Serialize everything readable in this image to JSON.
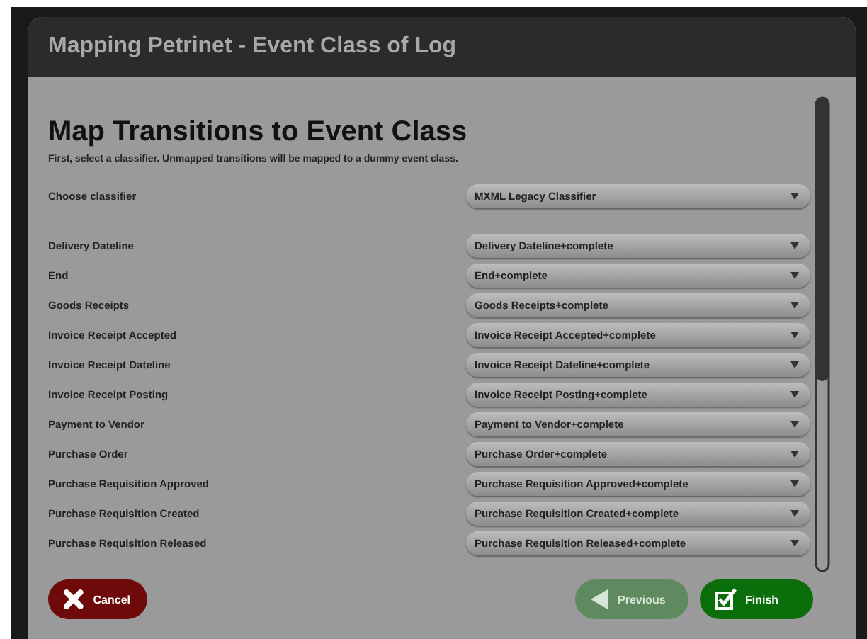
{
  "window": {
    "title": "Mapping Petrinet - Event Class of Log"
  },
  "heading": "Map Transitions to Event Class",
  "instruction": "First, select a classifier. Unmapped transitions will be mapped to a dummy event class.",
  "classifier": {
    "label": "Choose classifier",
    "value": "MXML Legacy Classifier"
  },
  "mappings": [
    {
      "label": "Delivery Dateline",
      "value": "Delivery Dateline+complete"
    },
    {
      "label": "End",
      "value": "End+complete"
    },
    {
      "label": "Goods Receipts",
      "value": "Goods Receipts+complete"
    },
    {
      "label": "Invoice Receipt Accepted",
      "value": "Invoice Receipt Accepted+complete"
    },
    {
      "label": "Invoice Receipt Dateline",
      "value": "Invoice Receipt Dateline+complete"
    },
    {
      "label": "Invoice Receipt Posting",
      "value": "Invoice Receipt Posting+complete"
    },
    {
      "label": "Payment to Vendor",
      "value": "Payment to Vendor+complete"
    },
    {
      "label": "Purchase Order",
      "value": "Purchase Order+complete"
    },
    {
      "label": "Purchase Requisition Approved",
      "value": "Purchase Requisition Approved+complete"
    },
    {
      "label": "Purchase Requisition Created",
      "value": "Purchase Requisition Created+complete"
    },
    {
      "label": "Purchase Requisition Released",
      "value": "Purchase Requisition Released+complete"
    }
  ],
  "buttons": [
    {
      "kind": "cancel",
      "label": "Cancel",
      "disabled": false
    },
    {
      "kind": "previous",
      "label": "Previous",
      "disabled": true
    },
    {
      "kind": "finish",
      "label": "Finish",
      "disabled": false
    }
  ]
}
